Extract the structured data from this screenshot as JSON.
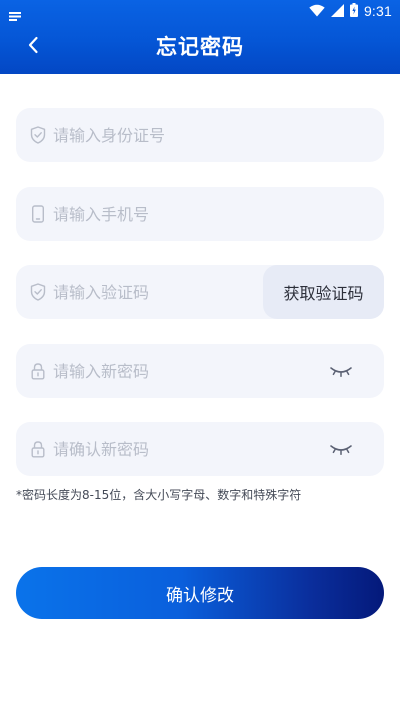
{
  "status_bar": {
    "time": "9:31",
    "icons": [
      "notification-icon",
      "wifi-icon",
      "cellular-signal-icon",
      "battery-icon"
    ]
  },
  "header": {
    "title": "忘记密码",
    "back_icon": "chevron-left-icon"
  },
  "form": {
    "id_number": {
      "placeholder": "请输入身份证号",
      "icon": "shield-check-icon"
    },
    "phone": {
      "placeholder": "请输入手机号",
      "icon": "phone-icon"
    },
    "verify_code": {
      "placeholder": "请输入验证码",
      "icon": "shield-check-icon",
      "button_label": "获取验证码"
    },
    "new_password": {
      "placeholder": "请输入新密码",
      "icon": "lock-icon",
      "toggle_icon": "eye-closed-icon"
    },
    "confirm_password": {
      "placeholder": "请确认新密码",
      "icon": "lock-icon",
      "toggle_icon": "eye-closed-icon"
    }
  },
  "hint": "*密码长度为8-15位，含大小写字母、数字和特殊字符",
  "submit_label": "确认修改",
  "colors": {
    "header_blue": "#0556d6",
    "field_bg": "#f3f5fb",
    "placeholder": "#b8bdc9",
    "button_start": "#0a73ea",
    "button_end": "#04197a"
  }
}
